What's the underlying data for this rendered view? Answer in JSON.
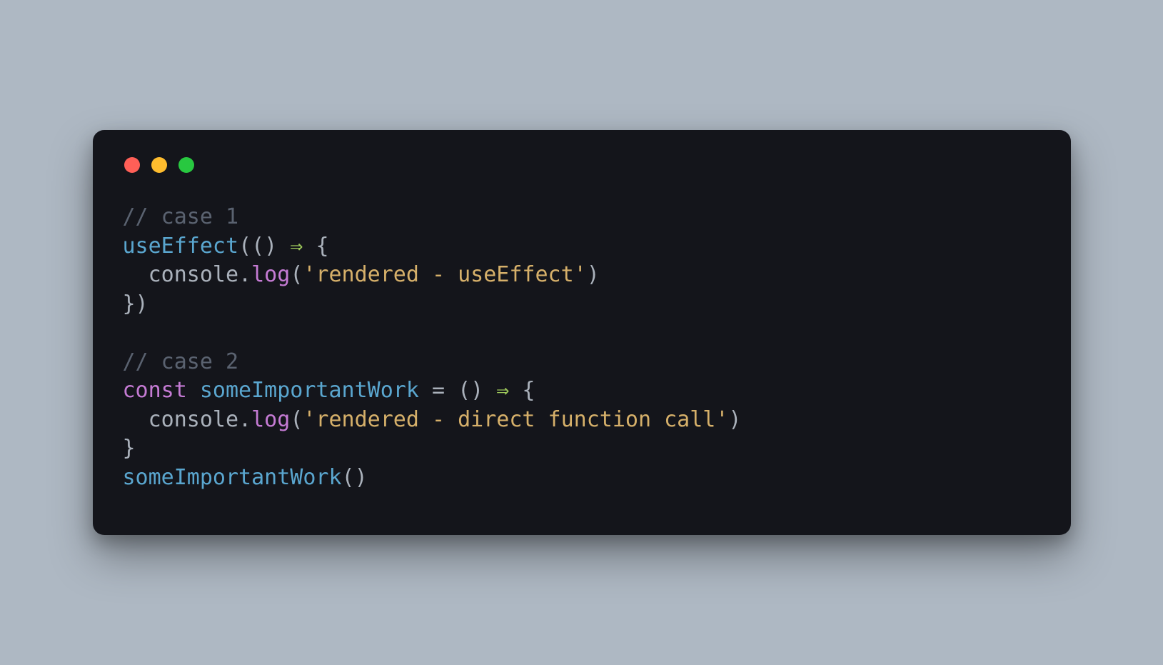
{
  "code": {
    "c1": "// case 1",
    "l2a": "useEffect",
    "l2b": "(()",
    "l2c": " ⇒ ",
    "l2d": "{",
    "l3a": "  console",
    "l3b": ".",
    "l3c": "log",
    "l3d": "(",
    "l3e": "'rendered - useEffect'",
    "l3f": ")",
    "l4": "})",
    "blank": "",
    "c2": "// case 2",
    "l7a": "const",
    "l7b": " someImportantWork ",
    "l7c": "=",
    "l7d": " () ",
    "l7e": "⇒",
    "l7f": " {",
    "l8a": "  console",
    "l8b": ".",
    "l8c": "log",
    "l8d": "(",
    "l8e": "'rendered - direct function call'",
    "l8f": ")",
    "l9": "}",
    "l10a": "someImportantWork",
    "l10b": "()"
  }
}
